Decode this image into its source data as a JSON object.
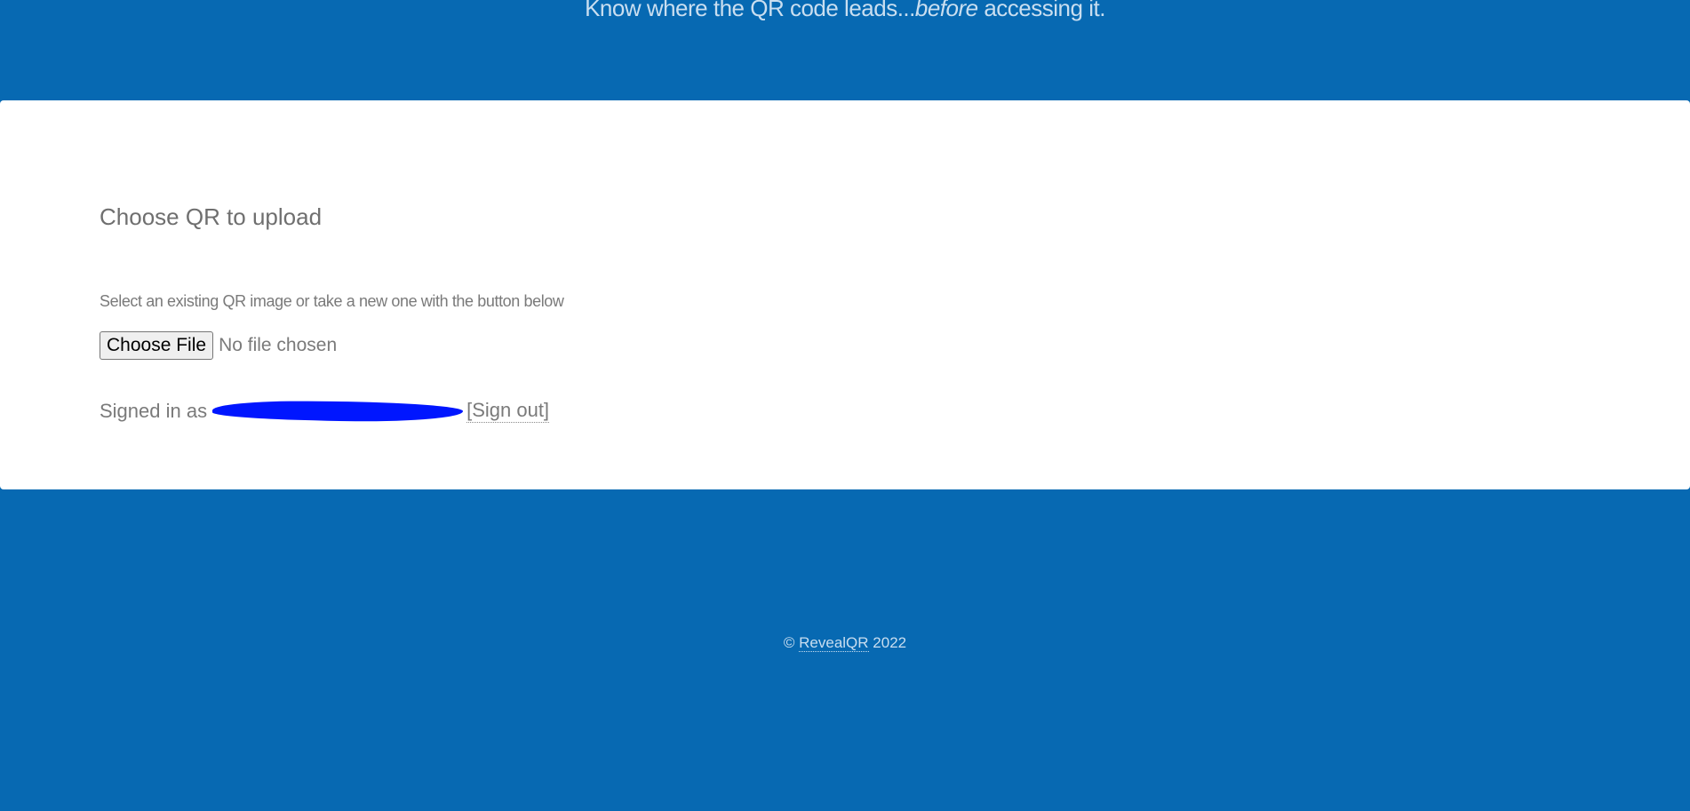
{
  "header": {
    "tagline_before": "Know where the QR code leads...",
    "tagline_emphasis": "before",
    "tagline_after": " accessing it."
  },
  "upload": {
    "title": "Choose QR to upload",
    "description": "Select an existing QR image or take a new one with the button below",
    "file_button_label": "Choose File",
    "file_status": "No file chosen"
  },
  "account": {
    "signed_in_prefix": "Signed in as",
    "sign_out_label": "[Sign out]"
  },
  "footer": {
    "copyright_symbol": "©",
    "brand": "RevealQR",
    "year": "2022"
  },
  "colors": {
    "background": "#0769b2",
    "card": "#ffffff",
    "redaction": "#0016ff"
  }
}
